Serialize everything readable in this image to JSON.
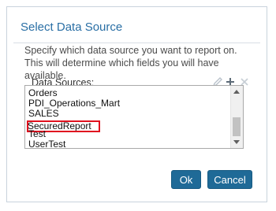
{
  "dialog": {
    "title": "Select Data Source",
    "description": "Specify which data source you want to report on. This will determine which fields you will have available.",
    "list_label": "Data Sources:",
    "items": [
      "Orders",
      "PDI_Operations_Mart",
      "SALES",
      "SecuredReport",
      "Test",
      "UserTest"
    ],
    "highlighted_item": "SecuredReport",
    "ok_label": "Ok",
    "cancel_label": "Cancel"
  },
  "toolbar_icons": [
    "pencil-icon",
    "plus-icon",
    "x-icon"
  ],
  "colors": {
    "title": "#2a6fa5",
    "button": "#1f6a97",
    "highlight_box": "#e0121f"
  }
}
